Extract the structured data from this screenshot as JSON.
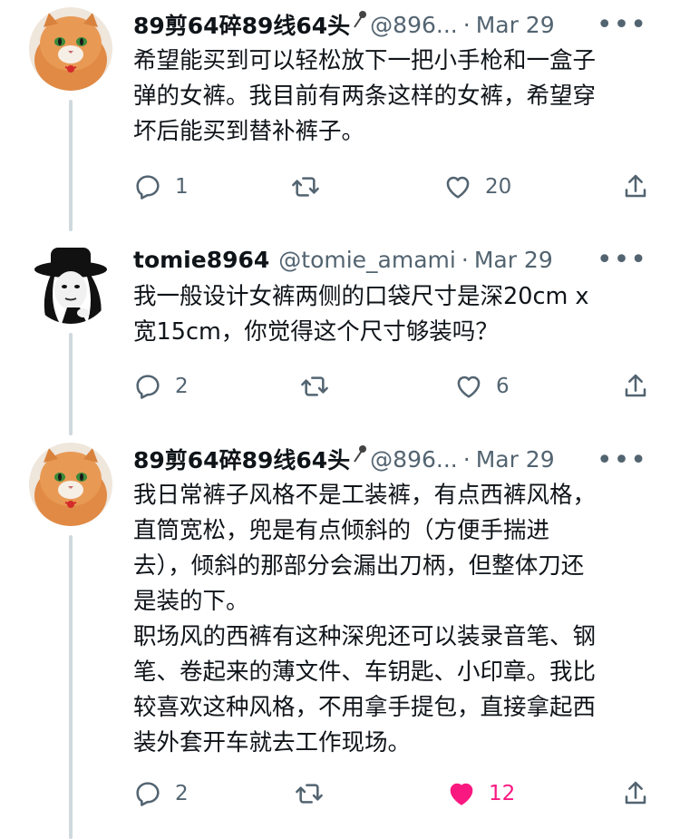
{
  "tweets": [
    {
      "name": "89剪64碎89线64头",
      "handle": "@896...",
      "separator": "·",
      "time": "Mar 29",
      "text": "希望能买到可以轻松放下一把小手枪和一盒子\n弹的女裤。我目前有两条这样的女裤，希望穿\n坏后能买到替补裤子。",
      "replies": "1",
      "retweets": "",
      "likes": "20",
      "liked": false
    },
    {
      "name": "tomie8964",
      "handle": "@tomie_amami",
      "separator": "·",
      "time": "Mar 29",
      "text": "我一般设计女裤两侧的口袋尺寸是深20cm x\n宽15cm，你觉得这个尺寸够装吗？",
      "replies": "2",
      "retweets": "",
      "likes": "6",
      "liked": false
    },
    {
      "name": "89剪64碎89线64头",
      "handle": "@896...",
      "separator": "·",
      "time": "Mar 29",
      "text": "我日常裤子风格不是工装裤，有点西裤风格，\n直筒宽松，兜是有点倾斜的（方便手揣进\n去），倾斜的那部分会漏出刀柄，但整体刀还\n是装的下。\n职场风的西裤有这种深兜还可以装录音笔、钢\n笔、卷起来的薄文件、车钥匙、小印章。我比\n较喜欢这种风格，不用拿手提包，直接拿起西\n装外套开车就去工作现场。",
      "replies": "2",
      "retweets": "",
      "likes": "12",
      "liked": true
    }
  ],
  "colors": {
    "text": "#0f1419",
    "secondary": "#536471",
    "like_active": "#f91880",
    "thread_line": "#cfd9de"
  },
  "icons": [
    "reply-icon",
    "retweet-icon",
    "like-icon",
    "share-icon",
    "more-icon",
    "pin-icon"
  ]
}
